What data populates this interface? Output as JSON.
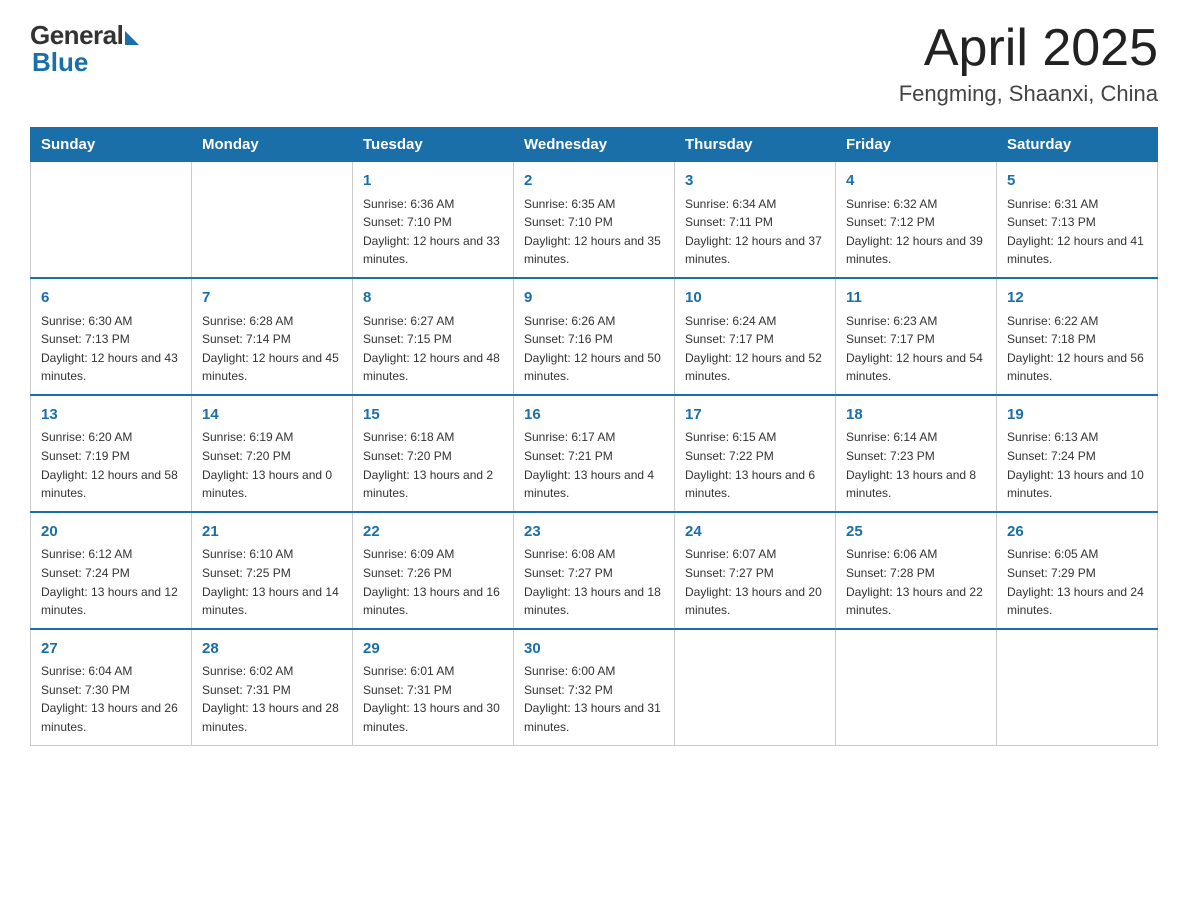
{
  "header": {
    "logo_general": "General",
    "logo_blue": "Blue",
    "title": "April 2025",
    "subtitle": "Fengming, Shaanxi, China"
  },
  "calendar": {
    "days_of_week": [
      "Sunday",
      "Monday",
      "Tuesday",
      "Wednesday",
      "Thursday",
      "Friday",
      "Saturday"
    ],
    "weeks": [
      [
        {
          "day": "",
          "sunrise": "",
          "sunset": "",
          "daylight": ""
        },
        {
          "day": "",
          "sunrise": "",
          "sunset": "",
          "daylight": ""
        },
        {
          "day": "1",
          "sunrise": "Sunrise: 6:36 AM",
          "sunset": "Sunset: 7:10 PM",
          "daylight": "Daylight: 12 hours and 33 minutes."
        },
        {
          "day": "2",
          "sunrise": "Sunrise: 6:35 AM",
          "sunset": "Sunset: 7:10 PM",
          "daylight": "Daylight: 12 hours and 35 minutes."
        },
        {
          "day": "3",
          "sunrise": "Sunrise: 6:34 AM",
          "sunset": "Sunset: 7:11 PM",
          "daylight": "Daylight: 12 hours and 37 minutes."
        },
        {
          "day": "4",
          "sunrise": "Sunrise: 6:32 AM",
          "sunset": "Sunset: 7:12 PM",
          "daylight": "Daylight: 12 hours and 39 minutes."
        },
        {
          "day": "5",
          "sunrise": "Sunrise: 6:31 AM",
          "sunset": "Sunset: 7:13 PM",
          "daylight": "Daylight: 12 hours and 41 minutes."
        }
      ],
      [
        {
          "day": "6",
          "sunrise": "Sunrise: 6:30 AM",
          "sunset": "Sunset: 7:13 PM",
          "daylight": "Daylight: 12 hours and 43 minutes."
        },
        {
          "day": "7",
          "sunrise": "Sunrise: 6:28 AM",
          "sunset": "Sunset: 7:14 PM",
          "daylight": "Daylight: 12 hours and 45 minutes."
        },
        {
          "day": "8",
          "sunrise": "Sunrise: 6:27 AM",
          "sunset": "Sunset: 7:15 PM",
          "daylight": "Daylight: 12 hours and 48 minutes."
        },
        {
          "day": "9",
          "sunrise": "Sunrise: 6:26 AM",
          "sunset": "Sunset: 7:16 PM",
          "daylight": "Daylight: 12 hours and 50 minutes."
        },
        {
          "day": "10",
          "sunrise": "Sunrise: 6:24 AM",
          "sunset": "Sunset: 7:17 PM",
          "daylight": "Daylight: 12 hours and 52 minutes."
        },
        {
          "day": "11",
          "sunrise": "Sunrise: 6:23 AM",
          "sunset": "Sunset: 7:17 PM",
          "daylight": "Daylight: 12 hours and 54 minutes."
        },
        {
          "day": "12",
          "sunrise": "Sunrise: 6:22 AM",
          "sunset": "Sunset: 7:18 PM",
          "daylight": "Daylight: 12 hours and 56 minutes."
        }
      ],
      [
        {
          "day": "13",
          "sunrise": "Sunrise: 6:20 AM",
          "sunset": "Sunset: 7:19 PM",
          "daylight": "Daylight: 12 hours and 58 minutes."
        },
        {
          "day": "14",
          "sunrise": "Sunrise: 6:19 AM",
          "sunset": "Sunset: 7:20 PM",
          "daylight": "Daylight: 13 hours and 0 minutes."
        },
        {
          "day": "15",
          "sunrise": "Sunrise: 6:18 AM",
          "sunset": "Sunset: 7:20 PM",
          "daylight": "Daylight: 13 hours and 2 minutes."
        },
        {
          "day": "16",
          "sunrise": "Sunrise: 6:17 AM",
          "sunset": "Sunset: 7:21 PM",
          "daylight": "Daylight: 13 hours and 4 minutes."
        },
        {
          "day": "17",
          "sunrise": "Sunrise: 6:15 AM",
          "sunset": "Sunset: 7:22 PM",
          "daylight": "Daylight: 13 hours and 6 minutes."
        },
        {
          "day": "18",
          "sunrise": "Sunrise: 6:14 AM",
          "sunset": "Sunset: 7:23 PM",
          "daylight": "Daylight: 13 hours and 8 minutes."
        },
        {
          "day": "19",
          "sunrise": "Sunrise: 6:13 AM",
          "sunset": "Sunset: 7:24 PM",
          "daylight": "Daylight: 13 hours and 10 minutes."
        }
      ],
      [
        {
          "day": "20",
          "sunrise": "Sunrise: 6:12 AM",
          "sunset": "Sunset: 7:24 PM",
          "daylight": "Daylight: 13 hours and 12 minutes."
        },
        {
          "day": "21",
          "sunrise": "Sunrise: 6:10 AM",
          "sunset": "Sunset: 7:25 PM",
          "daylight": "Daylight: 13 hours and 14 minutes."
        },
        {
          "day": "22",
          "sunrise": "Sunrise: 6:09 AM",
          "sunset": "Sunset: 7:26 PM",
          "daylight": "Daylight: 13 hours and 16 minutes."
        },
        {
          "day": "23",
          "sunrise": "Sunrise: 6:08 AM",
          "sunset": "Sunset: 7:27 PM",
          "daylight": "Daylight: 13 hours and 18 minutes."
        },
        {
          "day": "24",
          "sunrise": "Sunrise: 6:07 AM",
          "sunset": "Sunset: 7:27 PM",
          "daylight": "Daylight: 13 hours and 20 minutes."
        },
        {
          "day": "25",
          "sunrise": "Sunrise: 6:06 AM",
          "sunset": "Sunset: 7:28 PM",
          "daylight": "Daylight: 13 hours and 22 minutes."
        },
        {
          "day": "26",
          "sunrise": "Sunrise: 6:05 AM",
          "sunset": "Sunset: 7:29 PM",
          "daylight": "Daylight: 13 hours and 24 minutes."
        }
      ],
      [
        {
          "day": "27",
          "sunrise": "Sunrise: 6:04 AM",
          "sunset": "Sunset: 7:30 PM",
          "daylight": "Daylight: 13 hours and 26 minutes."
        },
        {
          "day": "28",
          "sunrise": "Sunrise: 6:02 AM",
          "sunset": "Sunset: 7:31 PM",
          "daylight": "Daylight: 13 hours and 28 minutes."
        },
        {
          "day": "29",
          "sunrise": "Sunrise: 6:01 AM",
          "sunset": "Sunset: 7:31 PM",
          "daylight": "Daylight: 13 hours and 30 minutes."
        },
        {
          "day": "30",
          "sunrise": "Sunrise: 6:00 AM",
          "sunset": "Sunset: 7:32 PM",
          "daylight": "Daylight: 13 hours and 31 minutes."
        },
        {
          "day": "",
          "sunrise": "",
          "sunset": "",
          "daylight": ""
        },
        {
          "day": "",
          "sunrise": "",
          "sunset": "",
          "daylight": ""
        },
        {
          "day": "",
          "sunrise": "",
          "sunset": "",
          "daylight": ""
        }
      ]
    ]
  }
}
